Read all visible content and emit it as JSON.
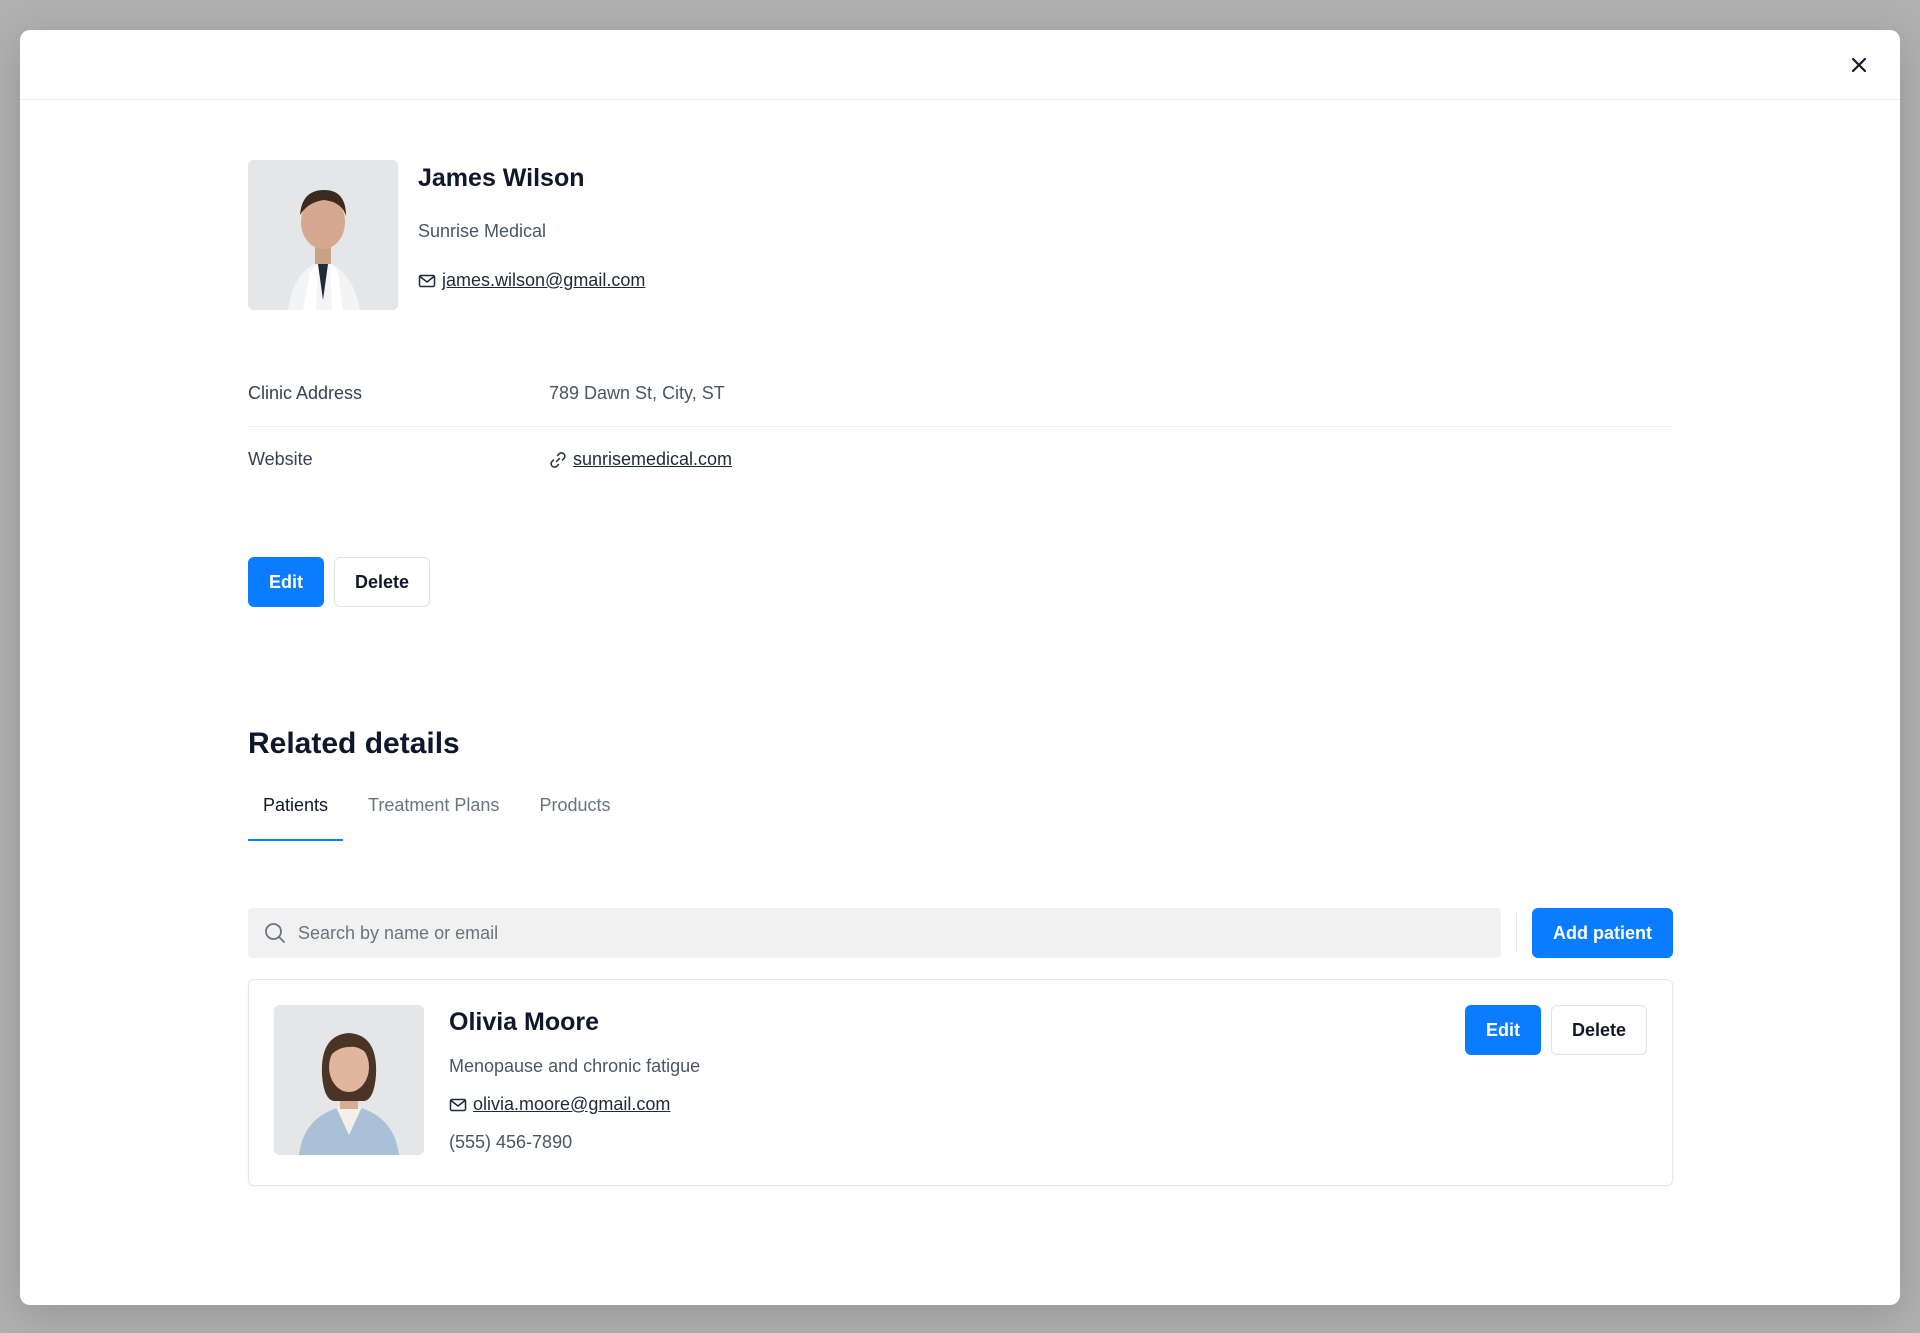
{
  "modal": {
    "close_label": "×"
  },
  "profile": {
    "name": "James Wilson",
    "company": "Sunrise Medical",
    "email": "james.wilson@gmail.com",
    "photo_icon": "doctor-portrait"
  },
  "details": [
    {
      "label": "Clinic Address",
      "value": "789 Dawn St, City, ST"
    },
    {
      "label": "Website",
      "value": "sunrisemedical.com"
    }
  ],
  "actions": {
    "edit_label": "Edit",
    "delete_label": "Delete"
  },
  "related": {
    "title": "Related details",
    "tabs": [
      {
        "label": "Patients",
        "active": true
      },
      {
        "label": "Treatment Plans",
        "active": false
      },
      {
        "label": "Products",
        "active": false
      }
    ]
  },
  "search": {
    "placeholder": "Search by name or email",
    "value": ""
  },
  "add_patient_label": "Add patient",
  "patients": [
    {
      "name": "Olivia Moore",
      "condition": "Menopause and chronic fatigue",
      "email": "olivia.moore@gmail.com",
      "phone": "(555) 456-7890",
      "edit_label": "Edit",
      "delete_label": "Delete"
    }
  ],
  "colors": {
    "primary": "#0a7cff",
    "overlay": "#b0b0b0",
    "heading": "#0f172a"
  }
}
